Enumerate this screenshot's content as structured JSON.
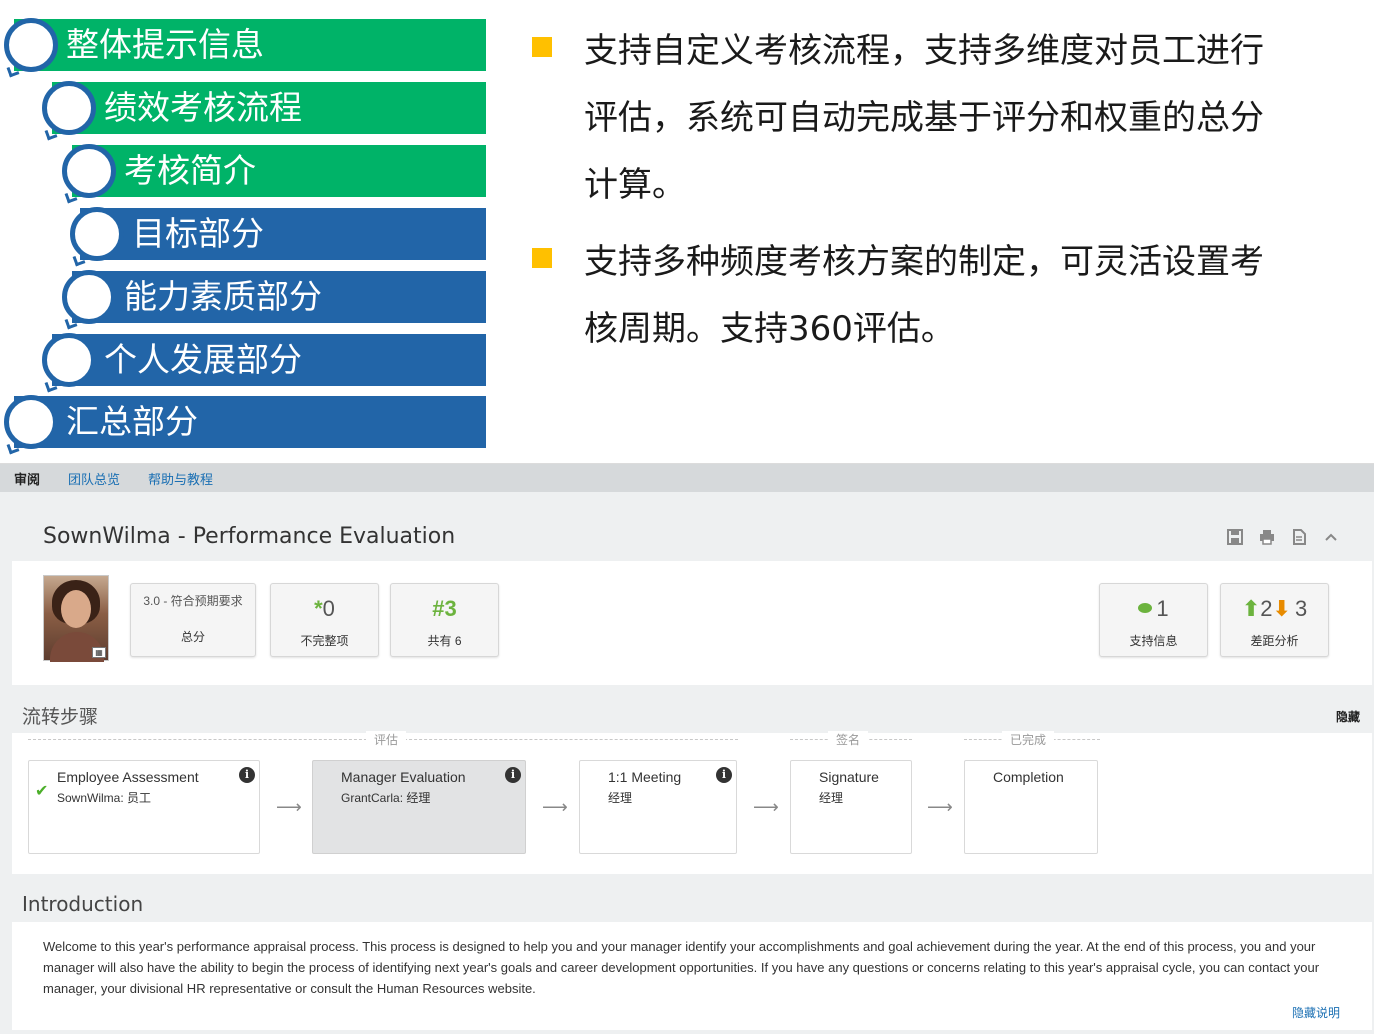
{
  "outline": {
    "items": [
      {
        "label": "整体提示信息",
        "color": "green"
      },
      {
        "label": "绩效考核流程",
        "color": "green"
      },
      {
        "label": "考核简介",
        "color": "green"
      },
      {
        "label": "目标部分",
        "color": "blue"
      },
      {
        "label": "能力素质部分",
        "color": "blue"
      },
      {
        "label": "个人发展部分",
        "color": "blue"
      },
      {
        "label": "汇总部分",
        "color": "blue"
      }
    ]
  },
  "bullets": [
    {
      "lines": [
        "支持自定义考核流程，支持多维度对员工进行",
        "评估，系统可自动完成基于评分和权重的总分",
        "计算。"
      ]
    },
    {
      "lines": [
        "支持多种频度考核方案的制定，可灵活设置考",
        "核周期。支持360评估。"
      ]
    }
  ],
  "app": {
    "nav": {
      "active": "审阅",
      "items": [
        "团队总览",
        "帮助与教程"
      ]
    },
    "title": "SownWilma - Performance Evaluation",
    "summary": {
      "score": {
        "value": "3.0 - 符合预期要求",
        "label": "总分"
      },
      "incomplete": {
        "symbol": "*",
        "count": "0",
        "label": "不完整项"
      },
      "rank": {
        "symbol": "#",
        "value": "3",
        "label": "共有 6"
      },
      "support": {
        "count": "1",
        "label": "支持信息"
      },
      "gap": {
        "up": "2",
        "down": "3",
        "label": "差距分析"
      }
    },
    "flow": {
      "title": "流转步骤",
      "hide_label": "隐藏",
      "phases": [
        "评估",
        "签名",
        "已完成"
      ],
      "steps": [
        {
          "title": "Employee Assessment",
          "sub": "SownWilma: 员工",
          "done": true
        },
        {
          "title": "Manager Evaluation",
          "sub": "GrantCarla: 经理",
          "current": true
        },
        {
          "title": "1:1 Meeting",
          "sub": "经理"
        },
        {
          "title": "Signature",
          "sub": "经理"
        },
        {
          "title": "Completion",
          "sub": ""
        }
      ]
    },
    "intro": {
      "title": "Introduction",
      "text": "Welcome to this year's performance appraisal process. This process is designed to help you and your manager identify your accomplishments and goal achievement during the year. At the end of this process, you and your manager will also have the ability to begin the process of identifying next year's goals and career development opportunities. If you have any questions or concerns relating to this year's appraisal cycle, you can contact your manager, your divisional HR representative or consult the Human Resources website.",
      "hide_label": "隐藏说明"
    }
  },
  "colors": {
    "green": "#00b368",
    "blue": "#2265a8",
    "bullet": "#ffc000",
    "link": "#1a6fb3"
  }
}
